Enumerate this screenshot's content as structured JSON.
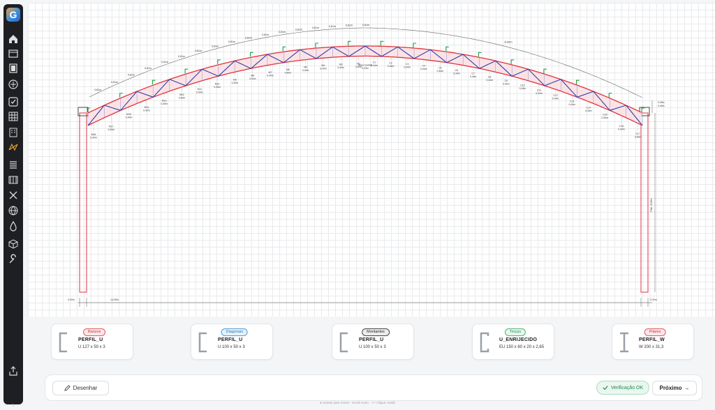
{
  "app": {
    "logo_letter": "G"
  },
  "sidebar": {
    "icons": [
      "home-icon",
      "window-icon",
      "door-icon",
      "layers-icon",
      "badge-check-icon",
      "grid-icon",
      "building-icon",
      "truss-icon",
      "list-icon",
      "ruler-icon",
      "tools-icon",
      "globe-icon",
      "drop-icon",
      "cube-icon",
      "wrench-icon",
      "export-icon",
      "chevron-right-icon"
    ],
    "expand_label": "›"
  },
  "drawing": {
    "arc_segment_label": "0,81m",
    "arc_right_label": "8,30m",
    "span_label": "14,00m",
    "left_offset_label": "0,00m",
    "right_offset_label": "0,20m",
    "height_label": "Pilar: 8,00m",
    "right_top_label": "0,25m",
    "right_top_label2": "0,40m",
    "center_label": "Meio Central",
    "center_value": "0,40m",
    "node_labels_left": [
      {
        "name": "M16",
        "value": "0,40m"
      },
      {
        "name": "M17",
        "value": "0,40m"
      },
      {
        "name": "M15",
        "value": "0,40m"
      },
      {
        "name": "M14",
        "value": "0,40m"
      },
      {
        "name": "M13",
        "value": "0,40m"
      },
      {
        "name": "M12",
        "value": "0,40m"
      },
      {
        "name": "M11",
        "value": "0,40m"
      },
      {
        "name": "M10",
        "value": "0,40m"
      },
      {
        "name": "M9",
        "value": "0,40m"
      },
      {
        "name": "M8",
        "value": "0,40m"
      },
      {
        "name": "M7",
        "value": "0,40m"
      },
      {
        "name": "M6",
        "value": "0,40m"
      },
      {
        "name": "M5",
        "value": "0,40m"
      },
      {
        "name": "M4",
        "value": "0,40m"
      },
      {
        "name": "M3",
        "value": "0,40m"
      },
      {
        "name": "M2",
        "value": "0,40m"
      }
    ],
    "node_labels_right": [
      {
        "name": "C1",
        "value": "0,44m"
      },
      {
        "name": "C2",
        "value": "0,44m"
      },
      {
        "name": "C3",
        "value": "0,44m"
      },
      {
        "name": "C4",
        "value": "0,44m"
      },
      {
        "name": "C5",
        "value": "0,44m"
      },
      {
        "name": "C6",
        "value": "0,44m"
      },
      {
        "name": "C7",
        "value": "0,44m"
      },
      {
        "name": "C8",
        "value": "0,44m"
      },
      {
        "name": "C9",
        "value": "0,44m"
      },
      {
        "name": "C10",
        "value": "0,44m"
      },
      {
        "name": "C11",
        "value": "0,44m"
      },
      {
        "name": "C12",
        "value": "0,44m"
      },
      {
        "name": "C13",
        "value": "0,44m"
      },
      {
        "name": "C14",
        "value": "0,44m"
      },
      {
        "name": "C15",
        "value": "0,44m"
      },
      {
        "name": "C16",
        "value": "0,44m"
      },
      {
        "name": "C17",
        "value": "0,63m"
      }
    ],
    "colors": {
      "chord": "#e0323c",
      "diagonal": "#2a3fb0",
      "web_fill": "#ef9aa0",
      "dim": "#555555",
      "purlin": "#1f9d3f"
    }
  },
  "profiles": [
    {
      "badge": "Banzos",
      "type": "PERFIL_U",
      "dims": "U 127 x 50 x 3",
      "badge_bg": "#fde7e8",
      "badge_border": "#e05a63",
      "badge_color": "#c0303a",
      "shape": "u"
    },
    {
      "badge": "Diagonais",
      "type": "PERFIL_U",
      "dims": "U 100 x 50 x 3",
      "badge_bg": "#e3f1fb",
      "badge_border": "#4f9fd8",
      "badge_color": "#2a76b5",
      "shape": "u"
    },
    {
      "badge": "Montantes",
      "type": "PERFIL_U",
      "dims": "U 100 x 50 x 3",
      "badge_bg": "#ececec",
      "badge_border": "#444444",
      "badge_color": "#222222",
      "shape": "u"
    },
    {
      "badge": "Terças",
      "type": "U_ENRIJECIDO",
      "dims": "EU 150 x 60 x 20 x 2,65",
      "badge_bg": "#e6f6ec",
      "badge_border": "#4fb57a",
      "badge_color": "#2a8a55",
      "shape": "eu"
    },
    {
      "badge": "Pilares",
      "type": "PERFIL_W",
      "dims": "W 200 x 31,3",
      "badge_bg": "#fde7e8",
      "badge_border": "#e05a63",
      "badge_color": "#c0303a",
      "shape": "w"
    }
  ],
  "actions": {
    "draw_label": "Desenhar",
    "verify_label": "Verificação OK",
    "next_label": "Próximo",
    "next_arrow": "→",
    "footer_hint": "● Arraste para mover · Scroll zoom · ⇧+ Clique: medir"
  }
}
